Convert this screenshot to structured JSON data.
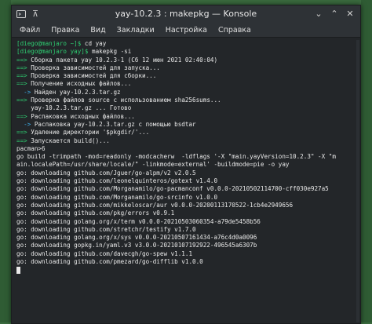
{
  "window": {
    "title": "yay-10.2.3 : makepkg — Konsole",
    "icons": {
      "app": "konsole-icon",
      "pin": "pin-icon",
      "minimize": "chevron-down-icon",
      "maximize": "chevron-up-icon",
      "close": "close-icon"
    },
    "min_glyph": "⌄",
    "max_glyph": "⌃",
    "close_glyph": "✕",
    "pin_glyph": "⊼"
  },
  "menu": [
    "Файл",
    "Правка",
    "Вид",
    "Закладки",
    "Настройка",
    "Справка"
  ],
  "terminal": {
    "lines": [
      [
        {
          "t": "[diego@manjaro ~]$ ",
          "c": "g"
        },
        {
          "t": "cd yay",
          "c": "w"
        }
      ],
      [
        {
          "t": "[diego@manjaro yay]$ ",
          "c": "g"
        },
        {
          "t": "makepkg -si",
          "c": "w"
        }
      ],
      [
        {
          "t": "==> ",
          "c": "g"
        },
        {
          "t": "Сборка пакета yay 10.2.3-1 (Сб 12 июн 2021 02:40:04)",
          "c": "w"
        }
      ],
      [
        {
          "t": "==> ",
          "c": "g"
        },
        {
          "t": "Проверка зависимостей для запуска...",
          "c": "w"
        }
      ],
      [
        {
          "t": "==> ",
          "c": "g"
        },
        {
          "t": "Проверка зависимостей для сборки...",
          "c": "w"
        }
      ],
      [
        {
          "t": "==> ",
          "c": "g"
        },
        {
          "t": "Получение исходных файлов...",
          "c": "w"
        }
      ],
      [
        {
          "t": "  -> ",
          "c": "bl"
        },
        {
          "t": "Найден yay-10.2.3.tar.gz",
          "c": "w"
        }
      ],
      [
        {
          "t": "==> ",
          "c": "g"
        },
        {
          "t": "Проверка файлов source с использованием sha256sums...",
          "c": "w"
        }
      ],
      [
        {
          "t": "    yay-10.2.3.tar.gz ... Готово",
          "c": "w"
        }
      ],
      [
        {
          "t": "==> ",
          "c": "g"
        },
        {
          "t": "Распаковка исходных файлов...",
          "c": "w"
        }
      ],
      [
        {
          "t": "  -> ",
          "c": "bl"
        },
        {
          "t": "Распаковка yay-10.2.3.tar.gz с помощью bsdtar",
          "c": "w"
        }
      ],
      [
        {
          "t": "==> ",
          "c": "g"
        },
        {
          "t": "Удаление директории '$pkgdir/'...",
          "c": "w"
        }
      ],
      [
        {
          "t": "==> ",
          "c": "g"
        },
        {
          "t": "Запускается build()...",
          "c": "w"
        }
      ],
      [
        {
          "t": "pacman>6",
          "c": "w"
        }
      ],
      [
        {
          "t": "go build -trimpath -mod=readonly -modcacherw  -ldflags '-X \"main.yayVersion=10.2.3\" -X \"m",
          "c": "w"
        }
      ],
      [
        {
          "t": "ain.localePath=/usr/share/locale/\" -linkmode=external' -buildmode=pie -o yay",
          "c": "w"
        }
      ],
      [
        {
          "t": "go: downloading github.com/Jguer/go-alpm/v2 v2.0.5",
          "c": "w"
        }
      ],
      [
        {
          "t": "go: downloading github.com/leonelquinteros/gotext v1.4.0",
          "c": "w"
        }
      ],
      [
        {
          "t": "go: downloading github.com/Morganamilo/go-pacmanconf v0.0.0-20210502114700-cff030e927a5",
          "c": "w"
        }
      ],
      [
        {
          "t": "go: downloading github.com/Morganamilo/go-srcinfo v1.0.0",
          "c": "w"
        }
      ],
      [
        {
          "t": "go: downloading github.com/mikkeloscar/aur v0.0.0-20200113170522-1cb4e2949656",
          "c": "w"
        }
      ],
      [
        {
          "t": "go: downloading github.com/pkg/errors v0.9.1",
          "c": "w"
        }
      ],
      [
        {
          "t": "go: downloading golang.org/x/term v0.0.0-20210503060354-a79de5458b56",
          "c": "w"
        }
      ],
      [
        {
          "t": "go: downloading github.com/stretchr/testify v1.7.0",
          "c": "w"
        }
      ],
      [
        {
          "t": "go: downloading golang.org/x/sys v0.0.0-20210507161434-a76c4d0a0096",
          "c": "w"
        }
      ],
      [
        {
          "t": "go: downloading gopkg.in/yaml.v3 v3.0.0-20210107192922-496545a6307b",
          "c": "w"
        }
      ],
      [
        {
          "t": "go: downloading github.com/davecgh/go-spew v1.1.1",
          "c": "w"
        }
      ],
      [
        {
          "t": "go: downloading github.com/pmezard/go-difflib v1.0.0",
          "c": "w"
        }
      ]
    ]
  },
  "colors": {
    "prompt_green": "#2ecc71",
    "arrow_blue": "#3daee9",
    "terminal_bg": "#232629"
  }
}
